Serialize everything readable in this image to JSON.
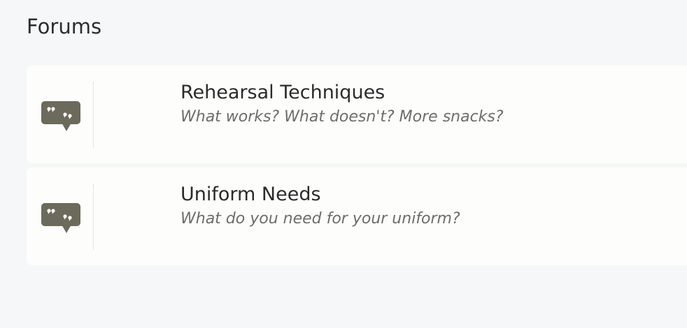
{
  "page": {
    "title": "Forums"
  },
  "forums": [
    {
      "title": "Rehearsal Techniques",
      "description": "What works? What doesn't? More snacks?",
      "icon": "speech-bubble-icon"
    },
    {
      "title": "Uniform Needs",
      "description": "What do you need for your uniform?",
      "icon": "speech-bubble-icon"
    }
  ],
  "colors": {
    "background": "#f6f7f9",
    "card": "#fdfdfc",
    "icon": "#6b6a5b",
    "title_text": "#2b2b2b",
    "description_text": "#6d6d6d"
  }
}
